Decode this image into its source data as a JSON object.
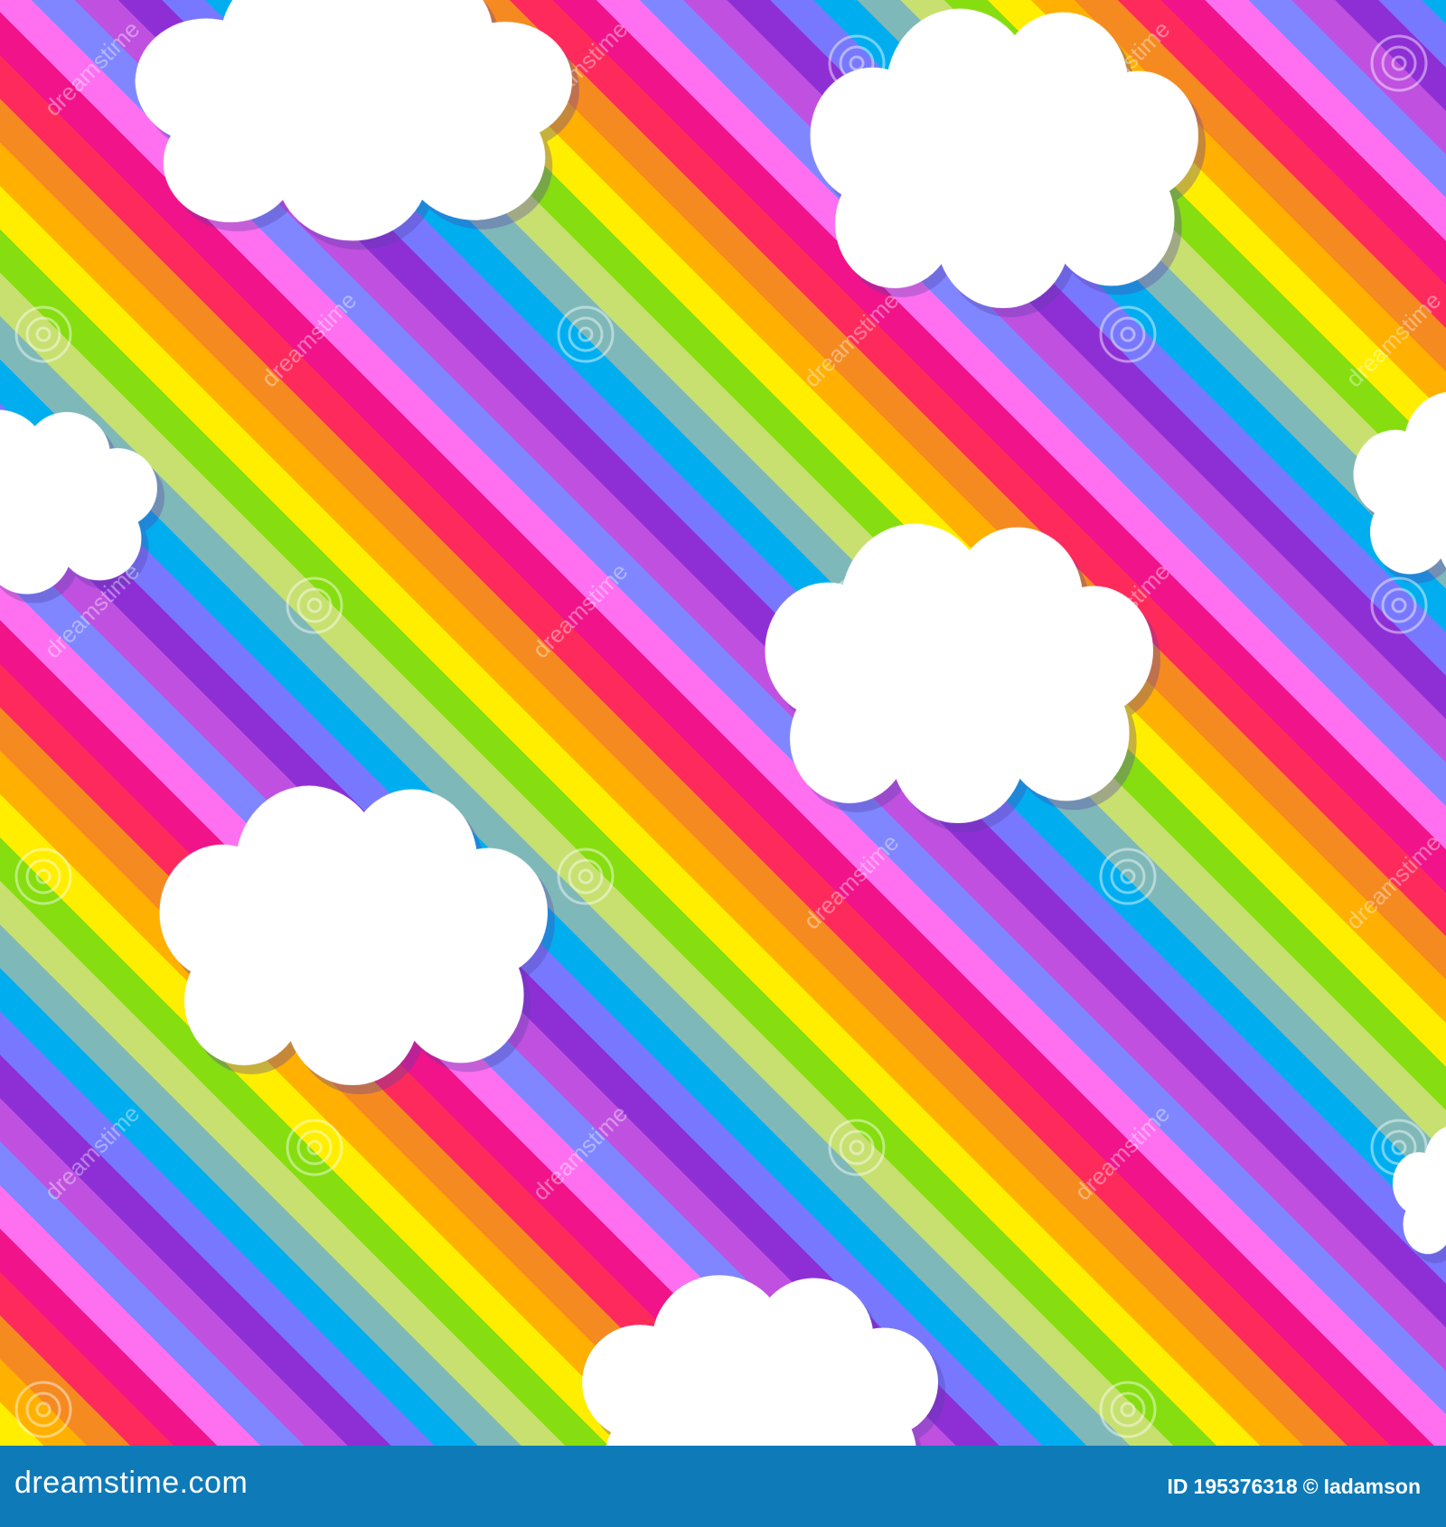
{
  "artwork": {
    "subject": "rainbow-stripes-with-clouds",
    "stripe_colors": [
      "#ffee00",
      "#ffb000",
      "#f58a20",
      "#ff2a5c",
      "#f0138a",
      "#ff70f0",
      "#7f86ff",
      "#c050e0",
      "#8e2fd6",
      "#7878ff",
      "#00aef0",
      "#7fb8b8",
      "#c7e070",
      "#86dd10"
    ],
    "cloud_color": "#ffffff",
    "cloud_count": 8,
    "watermark_text": "dreamstime"
  },
  "footer": {
    "background": "#0e7ab8",
    "site": "dreamstime.com",
    "id_label": "ID",
    "id_value": "195376318",
    "copyright_symbol": "©",
    "author": "Iadamson"
  }
}
